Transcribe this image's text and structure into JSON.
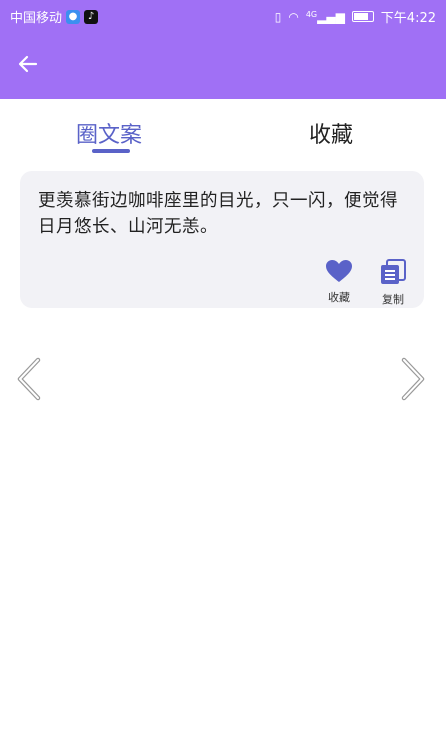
{
  "status_bar": {
    "carrier": "中国移动",
    "network": "4G",
    "time": "下午4:22"
  },
  "header": {
    "back_icon": "arrow-left-icon"
  },
  "tabs": [
    {
      "label": "圈文案",
      "active": true
    },
    {
      "label": "收藏",
      "active": false
    }
  ],
  "card": {
    "text": "更羡慕街边咖啡座里的目光，只一闪，便觉得日月悠长、山河无恙。",
    "favorite_label": "收藏",
    "copy_label": "复制"
  },
  "colors": {
    "header": "#a070f5",
    "accent": "#5a62c8",
    "card_bg": "#f2f2f6"
  }
}
